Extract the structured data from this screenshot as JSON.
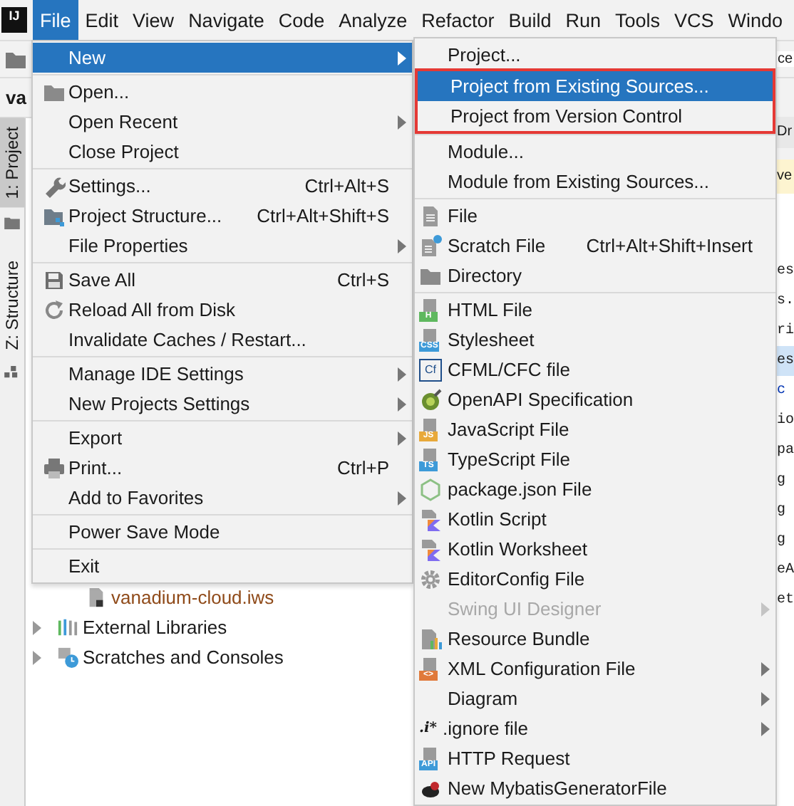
{
  "menu_bar": {
    "logo": "IJ",
    "items": [
      {
        "label": "File",
        "selected": true
      },
      {
        "label": "Edit",
        "selected": false
      },
      {
        "label": "View",
        "selected": false
      },
      {
        "label": "Navigate",
        "selected": false
      },
      {
        "label": "Code",
        "selected": false
      },
      {
        "label": "Analyze",
        "selected": false
      },
      {
        "label": "Refactor",
        "selected": false
      },
      {
        "label": "Build",
        "selected": false
      },
      {
        "label": "Run",
        "selected": false
      },
      {
        "label": "Tools",
        "selected": false
      },
      {
        "label": "VCS",
        "selected": false
      },
      {
        "label": "Windo",
        "selected": false
      }
    ]
  },
  "toolbar": {
    "field_text": "ce"
  },
  "project_panel": {
    "title": "va",
    "tool_tabs": [
      {
        "label": "1: Project",
        "selected": true
      },
      {
        "label": "Z: Structure",
        "selected": false
      }
    ],
    "tree": [
      {
        "label": "vanadium-cloud.iws",
        "kind": "iws",
        "expandable": false,
        "ignored": true
      },
      {
        "label": "External Libraries",
        "kind": "libraries",
        "expandable": true,
        "ignored": false
      },
      {
        "label": "Scratches and Consoles",
        "kind": "scratches",
        "expandable": true,
        "ignored": false
      }
    ]
  },
  "editor": {
    "tab": "Dr",
    "banner": "ve",
    "code_lines": [
      {
        "text": "es",
        "highlighted": false,
        "keyword": false
      },
      {
        "text": "s.",
        "highlighted": false,
        "keyword": false
      },
      {
        "text": "ri",
        "highlighted": false,
        "keyword": false
      },
      {
        "text": "es",
        "highlighted": true,
        "keyword": false
      },
      {
        "text": "c",
        "highlighted": false,
        "keyword": true
      },
      {
        "text": "io",
        "highlighted": false,
        "keyword": false
      },
      {
        "text": "pa",
        "highlighted": false,
        "keyword": false
      },
      {
        "text": "g",
        "highlighted": false,
        "keyword": false
      },
      {
        "text": "g",
        "highlighted": false,
        "keyword": false
      },
      {
        "text": "g",
        "highlighted": false,
        "keyword": false
      },
      {
        "text": "eA",
        "highlighted": false,
        "keyword": false
      },
      {
        "text": "et",
        "highlighted": false,
        "keyword": false
      }
    ]
  },
  "file_menu": {
    "groups": [
      [
        {
          "label": "New",
          "submenu": true,
          "selected": true
        }
      ],
      [
        {
          "label": "Open...",
          "kind": "folder",
          "submenu": false,
          "selected": false
        },
        {
          "label": "Open Recent",
          "submenu": true,
          "selected": false
        },
        {
          "label": "Close Project",
          "submenu": false,
          "selected": false
        }
      ],
      [
        {
          "label": "Settings...",
          "kind": "wrench",
          "shortcut": "Ctrl+Alt+S",
          "submenu": false,
          "selected": false
        },
        {
          "label": "Project Structure...",
          "kind": "structure",
          "shortcut": "Ctrl+Alt+Shift+S",
          "submenu": false,
          "selected": false
        },
        {
          "label": "File Properties",
          "submenu": true,
          "selected": false
        }
      ],
      [
        {
          "label": "Save All",
          "kind": "save",
          "shortcut": "Ctrl+S",
          "submenu": false,
          "selected": false
        },
        {
          "label": "Reload All from Disk",
          "kind": "reload",
          "submenu": false,
          "selected": false
        },
        {
          "label": "Invalidate Caches / Restart...",
          "submenu": false,
          "selected": false
        }
      ],
      [
        {
          "label": "Manage IDE Settings",
          "submenu": true,
          "selected": false
        },
        {
          "label": "New Projects Settings",
          "submenu": true,
          "selected": false
        }
      ],
      [
        {
          "label": "Export",
          "submenu": true,
          "selected": false
        },
        {
          "label": "Print...",
          "kind": "print",
          "shortcut": "Ctrl+P",
          "submenu": false,
          "selected": false
        },
        {
          "label": "Add to Favorites",
          "submenu": true,
          "selected": false
        }
      ],
      [
        {
          "label": "Power Save Mode",
          "submenu": false,
          "selected": false
        }
      ],
      [
        {
          "label": "Exit",
          "submenu": false,
          "selected": false
        }
      ]
    ]
  },
  "new_submenu": {
    "groups": [
      [
        {
          "label": "Project...",
          "submenu": false,
          "selected": false,
          "disabled": false,
          "framed": false
        },
        {
          "label": "Project from Existing Sources...",
          "submenu": false,
          "selected": true,
          "disabled": false,
          "framed": true
        },
        {
          "label": "Project from Version Control",
          "submenu": false,
          "selected": false,
          "disabled": false,
          "framed": true
        }
      ],
      [
        {
          "label": "Module...",
          "submenu": false,
          "selected": false,
          "disabled": false
        },
        {
          "label": "Module from Existing Sources...",
          "submenu": false,
          "selected": false,
          "disabled": false
        }
      ],
      [
        {
          "label": "File",
          "kind": "file",
          "submenu": false,
          "selected": false,
          "disabled": false
        },
        {
          "label": "Scratch File",
          "kind": "scratch",
          "shortcut": "Ctrl+Alt+Shift+Insert",
          "submenu": false,
          "selected": false,
          "disabled": false
        },
        {
          "label": "Directory",
          "kind": "folder",
          "submenu": false,
          "selected": false,
          "disabled": false
        }
      ],
      [
        {
          "label": "HTML File",
          "kind": "badge",
          "badge": "H",
          "submenu": false,
          "selected": false,
          "disabled": false
        },
        {
          "label": "Stylesheet",
          "kind": "badge",
          "badge": "CSS",
          "submenu": false,
          "selected": false,
          "disabled": false
        },
        {
          "label": "CFML/CFC file",
          "kind": "cfml",
          "badge": "Cf",
          "submenu": false,
          "selected": false,
          "disabled": false
        },
        {
          "label": "OpenAPI Specification",
          "kind": "openapi",
          "submenu": false,
          "selected": false,
          "disabled": false
        },
        {
          "label": "JavaScript File",
          "kind": "badge",
          "badge": "JS",
          "submenu": false,
          "selected": false,
          "disabled": false
        },
        {
          "label": "TypeScript File",
          "kind": "badge",
          "badge": "TS",
          "submenu": false,
          "selected": false,
          "disabled": false
        },
        {
          "label": "package.json File",
          "kind": "node",
          "submenu": false,
          "selected": false,
          "disabled": false
        },
        {
          "label": "Kotlin Script",
          "kind": "kotlin",
          "submenu": false,
          "selected": false,
          "disabled": false
        },
        {
          "label": "Kotlin Worksheet",
          "kind": "kotlin",
          "submenu": false,
          "selected": false,
          "disabled": false
        },
        {
          "label": "EditorConfig File",
          "kind": "gear",
          "submenu": false,
          "selected": false,
          "disabled": false
        },
        {
          "label": "Swing UI Designer",
          "submenu": true,
          "selected": false,
          "disabled": true
        },
        {
          "label": "Resource Bundle",
          "kind": "bundle",
          "submenu": false,
          "selected": false,
          "disabled": false
        },
        {
          "label": "XML Configuration File",
          "kind": "badge",
          "badge": "<>",
          "submenu": true,
          "selected": false,
          "disabled": false
        },
        {
          "label": "Diagram",
          "submenu": true,
          "selected": false,
          "disabled": false
        },
        {
          "label": ".ignore file",
          "kind": "text",
          "badge": ".i*",
          "submenu": true,
          "selected": false,
          "disabled": false
        },
        {
          "label": "HTTP Request",
          "kind": "badge",
          "badge": "API",
          "submenu": false,
          "selected": false,
          "disabled": false
        },
        {
          "label": "New MybatisGeneratorFile",
          "kind": "bird",
          "submenu": false,
          "selected": false,
          "disabled": false
        }
      ]
    ]
  }
}
